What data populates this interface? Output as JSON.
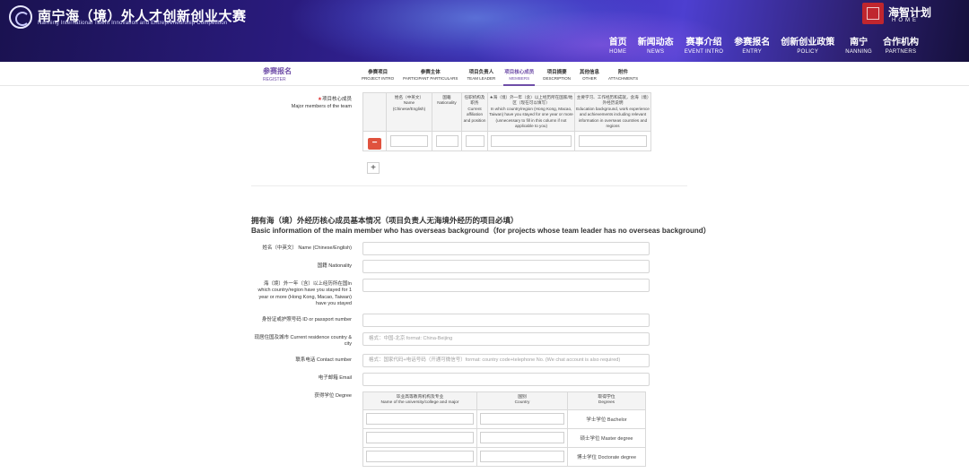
{
  "header": {
    "title": "南宁海（境）外人才创新创业大赛",
    "subtitle": "Nanning International Talent Innovation and Entrepreneurship Competition",
    "brand_name": "海智计划",
    "brand_en": "HOME",
    "nav": [
      {
        "cn": "首页",
        "en": "HOME"
      },
      {
        "cn": "新闻动态",
        "en": "NEWS"
      },
      {
        "cn": "赛事介绍",
        "en": "EVENT INTRO"
      },
      {
        "cn": "参赛报名",
        "en": "ENTRY"
      },
      {
        "cn": "创新创业政策",
        "en": "POLICY"
      },
      {
        "cn": "南宁",
        "en": "NANNING"
      },
      {
        "cn": "合作机构",
        "en": "PARTNERS"
      }
    ]
  },
  "register": {
    "cn": "参赛报名",
    "en": "REGISTER"
  },
  "tabs": [
    {
      "cn": "参赛项目",
      "en": "PROJECT INTRO",
      "active": false
    },
    {
      "cn": "参赛主体",
      "en": "PARTICIPANT PARTICULARS",
      "active": false
    },
    {
      "cn": "项目负责人",
      "en": "TEAM LEADER",
      "active": false
    },
    {
      "cn": "项目核心成员",
      "en": "MEMBERS",
      "active": true
    },
    {
      "cn": "项目摘要",
      "en": "DESCRIPTION",
      "active": false
    },
    {
      "cn": "其他信息",
      "en": "OTHER",
      "active": false
    },
    {
      "cn": "附件",
      "en": "ATTACHMENTS",
      "active": false
    }
  ],
  "members": {
    "label_cn": "项目核心成员",
    "label_en": "Major members of the team",
    "headers": [
      "姓名（中英文）\nName\n(Chinese/English)",
      "国籍\nNationality",
      "任职机构及职务\nCurrent affiliation and position",
      "★海（境）外一年（含）以上经历所在国家/地区（现在可以填写）\nIn which country/region (Hong Kong, Macao, Taiwan) have you stayed for one year or more (unnecessary to fill in this column if not applicable to you)",
      "主要学习、工作经历和成就，含海（境）外经历说明\nEducation background, work experience and achievements including relevant information in overseas countries and regions"
    ],
    "remove_label": "−",
    "add_label": "+"
  },
  "overseas": {
    "title_cn": "拥有海（境）外经历核心成员基本情况（项目负责人无海境外经历的项目必填）",
    "title_en": "Basic information of the main member who has overseas background（for projects whose team leader has no overseas background）",
    "fields": [
      {
        "label": "姓名（中英文） Name (Chinese/English)",
        "placeholder": ""
      },
      {
        "label": "国籍 Nationality",
        "placeholder": ""
      },
      {
        "label": "海（境）外一年（含）以上经历所在国In which country/region have you stayed for 1 year or more (Hong Kong, Macao, Taiwan) have you stayed",
        "placeholder": ""
      },
      {
        "label": "身份证或护照号码 ID or passport number",
        "placeholder": ""
      },
      {
        "label": "现居住国及城市 Current residence country & city",
        "placeholder": "格式：中国-北京 format: China-Beijing"
      },
      {
        "label": "联系电话 Contact number",
        "placeholder": "格式：国家代码+电话号码（开通可微信号）format: country code+telephone No. (We chat account is also required)"
      },
      {
        "label": "电子邮箱 Email",
        "placeholder": ""
      }
    ],
    "degree": {
      "label": "获得学位 Degree",
      "headers": [
        "毕业高等教育机构及专业\nName of the university/college and major",
        "国别\nCountry",
        "取得学位\nDegrees"
      ],
      "rows": [
        "学士学位 Bachelor",
        "硕士学位 Master degree",
        "博士学位 Doctorate degree"
      ]
    }
  }
}
